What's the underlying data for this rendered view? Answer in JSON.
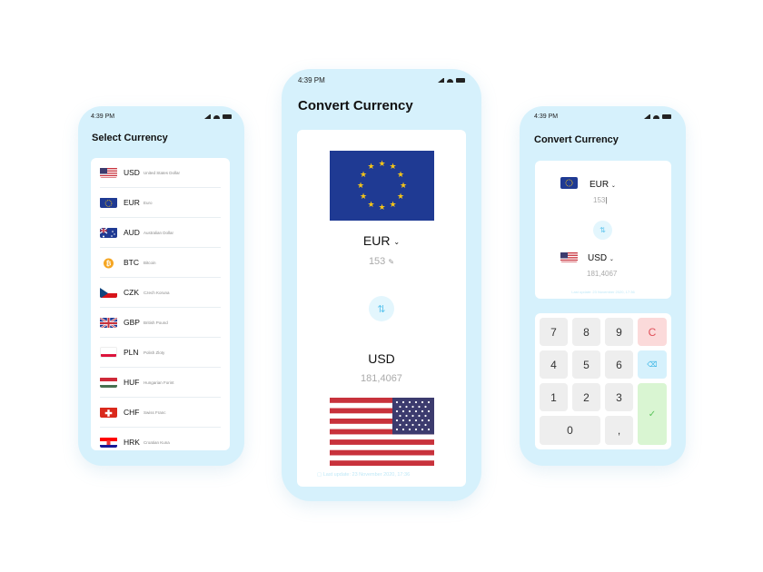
{
  "left": {
    "status": {
      "time": "4:39 PM"
    },
    "title": "Select Currency",
    "currencies": [
      {
        "code": "USD",
        "name": "United States Dollar",
        "flag": "us-flag-icon"
      },
      {
        "code": "EUR",
        "name": "Euro",
        "flag": "eu-flag-icon"
      },
      {
        "code": "AUD",
        "name": "Australian Dollar",
        "flag": "au-flag-icon"
      },
      {
        "code": "BTC",
        "name": "Bitcoin",
        "flag": "bitcoin-icon"
      },
      {
        "code": "CZK",
        "name": "Czech Koruna",
        "flag": "cz-flag-icon"
      },
      {
        "code": "GBP",
        "name": "British Pound",
        "flag": "gb-flag-icon"
      },
      {
        "code": "PLN",
        "name": "Polish Zloty",
        "flag": "pl-flag-icon"
      },
      {
        "code": "HUF",
        "name": "Hungarian Forint",
        "flag": "hu-flag-icon"
      },
      {
        "code": "CHF",
        "name": "Swiss Franc",
        "flag": "ch-flag-icon"
      },
      {
        "code": "HRK",
        "name": "Croatian Kuna",
        "flag": "hr-flag-icon"
      }
    ]
  },
  "middle": {
    "status": {
      "time": "4:39 PM"
    },
    "title": "Convert Currency",
    "from": {
      "code": "EUR",
      "amount": "153"
    },
    "to": {
      "code": "USD",
      "amount": "181,4067"
    },
    "last_update": "Last update: 23 November 2020, 17:36"
  },
  "right": {
    "status": {
      "time": "4:39 PM"
    },
    "title": "Convert Currency",
    "from": {
      "code": "EUR",
      "amount": "153"
    },
    "to": {
      "code": "USD",
      "amount": "181,4067"
    },
    "last_update": "Last update: 23 November 2020, 17:36",
    "keys": {
      "k7": "7",
      "k8": "8",
      "k9": "9",
      "clear": "C",
      "k4": "4",
      "k5": "5",
      "k6": "6",
      "k1": "1",
      "k2": "2",
      "k3": "3",
      "k0": "0",
      "comma": ","
    }
  },
  "colors": {
    "phone_bg": "#d6f1fc",
    "accent": "#5fc5ee",
    "clear_bg": "#fbdada",
    "confirm_bg": "#d9f5d2"
  }
}
